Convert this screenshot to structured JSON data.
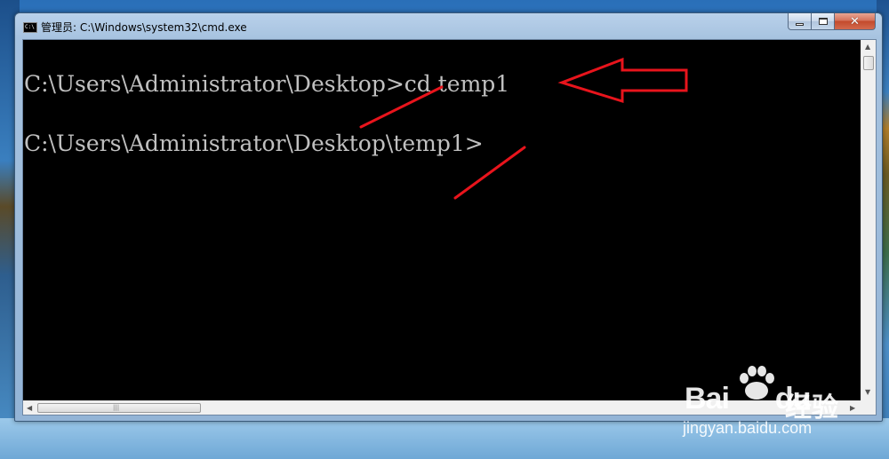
{
  "window": {
    "title": "管理员: C:\\Windows\\system32\\cmd.exe",
    "icon": "cmd-icon",
    "controls": {
      "minimize": "minimize-icon",
      "maximize": "maximize-icon",
      "close": "✕"
    }
  },
  "console": {
    "lines": [
      "C:\\Users\\Administrator\\Desktop>cd temp1",
      "C:\\Users\\Administrator\\Desktop\\temp1>"
    ],
    "text_color": "#c0c0c0",
    "background": "#000000"
  },
  "annotations": {
    "color": "#e8141c"
  },
  "watermark": {
    "logo": "Bai",
    "logo_suffix": "du",
    "brand_cn": "经验",
    "url": "jingyan.baidu.com"
  }
}
